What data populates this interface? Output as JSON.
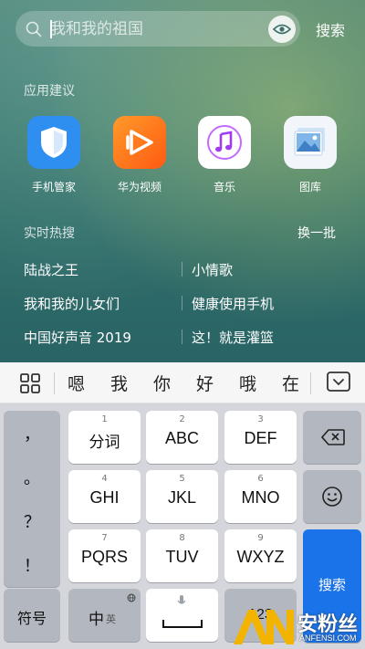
{
  "search": {
    "placeholder": "我和我的祖国",
    "submit_label": "搜索"
  },
  "suggest": {
    "title": "应用建议",
    "apps": [
      {
        "label": "手机管家",
        "icon": "shield-icon",
        "color": "#2f8ff0"
      },
      {
        "label": "华为视频",
        "icon": "play-icon",
        "color": "#ff7a1a"
      },
      {
        "label": "音乐",
        "icon": "music-note-icon",
        "color": "#ffffff"
      },
      {
        "label": "图库",
        "icon": "gallery-icon",
        "color": "#e8f2ff"
      }
    ]
  },
  "hot": {
    "title": "实时热搜",
    "refresh_label": "换一批",
    "items": [
      "陆战之王",
      "小情歌",
      "我和我的儿女们",
      "健康使用手机",
      "中国好声音 2019",
      "这！就是灌篮"
    ]
  },
  "candidates": [
    "嗯",
    "我",
    "你",
    "好",
    "哦",
    "在"
  ],
  "keyboard": {
    "punct": [
      "，",
      "。",
      "？",
      "！"
    ],
    "keys": [
      {
        "num": "1",
        "label": "分词"
      },
      {
        "num": "2",
        "label": "ABC"
      },
      {
        "num": "3",
        "label": "DEF"
      },
      {
        "num": "4",
        "label": "GHI"
      },
      {
        "num": "5",
        "label": "JKL"
      },
      {
        "num": "6",
        "label": "MNO"
      },
      {
        "num": "7",
        "label": "PQRS"
      },
      {
        "num": "8",
        "label": "TUV"
      },
      {
        "num": "9",
        "label": "WXYZ"
      }
    ],
    "symbols_label": "符号",
    "lang_label": "中",
    "lang_sub": "英",
    "numbers_label": "123",
    "enter_label": "搜索"
  },
  "watermark": {
    "logo": "AN",
    "text": "安粉丝",
    "sub": "ANFENSI.COM"
  },
  "colors": {
    "accent": "#1a73e8"
  }
}
